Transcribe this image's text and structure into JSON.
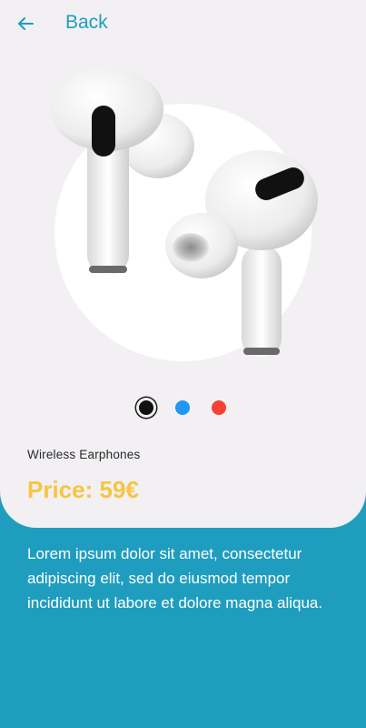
{
  "header": {
    "back_label": "Back"
  },
  "product": {
    "name": "Wireless Earphones",
    "price_text": "Price: 59€",
    "description": "Lorem ipsum dolor sit amet, consectetur adipiscing elit, sed do eiusmod tempor incididunt ut labore et dolore magna aliqua."
  },
  "colors": {
    "options": [
      "#111111",
      "#2196f3",
      "#f44336"
    ],
    "selected_index": 0,
    "accent": "#1f9dbf",
    "price": "#f7c541"
  }
}
